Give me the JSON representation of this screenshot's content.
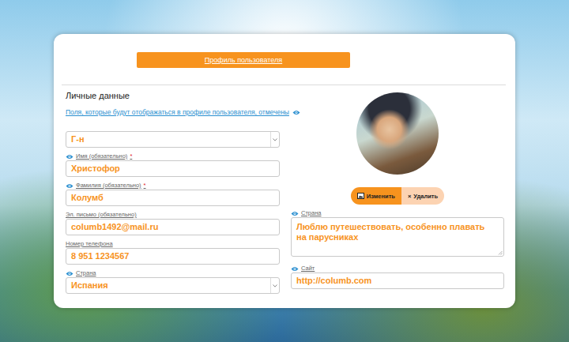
{
  "header_button": "Профиль пользователя",
  "section_title": "Личные данные",
  "visibility_note": "Поля, которые будут отображаться в профиле пользователя, отмечены",
  "photo_buttons": {
    "edit": "Изменить",
    "delete_icon": "×",
    "delete": "Удалить"
  },
  "left_fields": [
    {
      "kind": "select",
      "value": "Г-н",
      "visible": false
    },
    {
      "kind": "input",
      "label": "Имя (обязательно)",
      "required_mark": "*",
      "value": "Христофор",
      "visible": true
    },
    {
      "kind": "input",
      "label": "Фамилия (обязательно)",
      "required_mark": "*",
      "value": "Колумб",
      "visible": true
    },
    {
      "kind": "input",
      "label": "Эл. письмо (обязательно)",
      "value": "columb1492@mail.ru",
      "visible": false
    },
    {
      "kind": "input",
      "label": "Номер телефона",
      "value": "8 951 1234567",
      "visible": false
    },
    {
      "kind": "select",
      "label": "Страна",
      "value": "Испания",
      "visible": true
    }
  ],
  "right_fields": [
    {
      "kind": "textarea",
      "label": "Страна",
      "value": "Люблю путешествовать, особенно плавать\nна парусниках",
      "visible": true
    },
    {
      "kind": "input",
      "label": "Сайт",
      "value": "http://columb.com",
      "visible": true
    }
  ]
}
